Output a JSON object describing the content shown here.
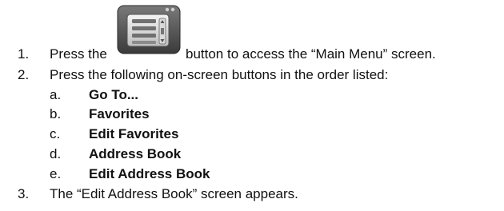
{
  "steps": [
    {
      "number": "1.",
      "text_before": "Press the",
      "icon": "main-menu-list-icon",
      "text_after": "button to access the “Main Menu” screen."
    },
    {
      "number": "2.",
      "text": "Press the following on-screen buttons in the order listed:",
      "substeps": [
        {
          "letter": "a.",
          "label": "Go To..."
        },
        {
          "letter": "b.",
          "label": "Favorites"
        },
        {
          "letter": "c.",
          "label": "Edit Favorites"
        },
        {
          "letter": "d.",
          "label": "Address Book"
        },
        {
          "letter": "e.",
          "label": "Edit Address Book"
        }
      ]
    },
    {
      "number": "3.",
      "text": "The “Edit Address Book” screen appears."
    }
  ]
}
